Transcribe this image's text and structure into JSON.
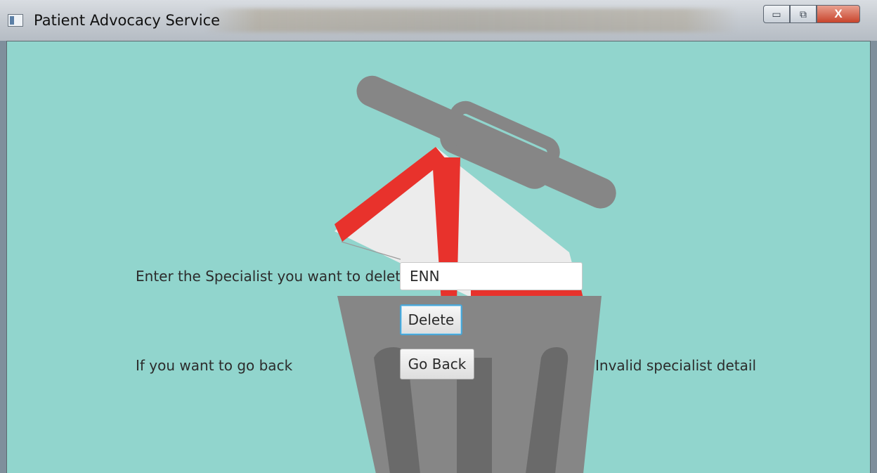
{
  "window": {
    "title": "Patient Advocacy Service",
    "controls": {
      "minimize": "▭",
      "maximize": "⧉",
      "close": "X"
    },
    "icons": {
      "app": "app-window-icon"
    }
  },
  "form": {
    "delete_prompt": "Enter the Specialist you want to delete",
    "specialist_input_value": "ENN",
    "delete_button": "Delete",
    "go_back_prompt": "If you want to go back",
    "go_back_button": "Go Back",
    "status_message": "Invalid specialist detail"
  },
  "colors": {
    "background": "#91d5cd",
    "trash_body": "#868686",
    "trash_stripes": "#6a6a6a",
    "envelope_red": "#e8322c",
    "envelope_paper": "#ececec"
  }
}
